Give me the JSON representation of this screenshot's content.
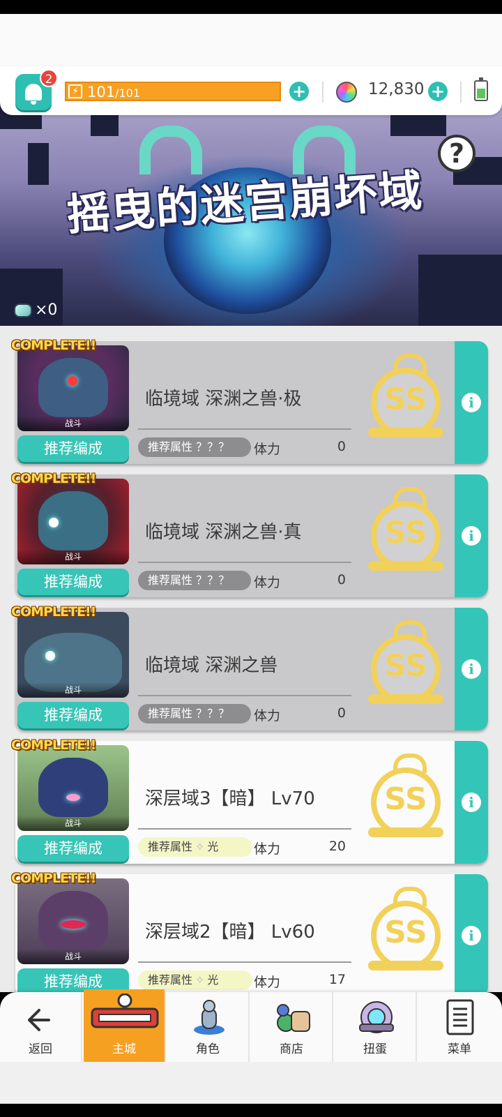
{
  "hud": {
    "notification_count": "2",
    "stamina_current": "101",
    "stamina_max": "/101",
    "gems": "12,830"
  },
  "banner": {
    "title": "摇曳的迷宫崩坏域",
    "help_label": "?",
    "ticket_count": "×0"
  },
  "quests": [
    {
      "complete_tag": "COMPLETE!!",
      "thumb_label": "战斗",
      "recommend_label": "推荐编成",
      "title": "临境域 深渊之兽·极",
      "attribute_label": "推荐属性 ？？？",
      "attribute_value": "",
      "stamina_label": "体力",
      "stamina_cost": "0",
      "rank": "SS"
    },
    {
      "complete_tag": "COMPLETE!!",
      "thumb_label": "战斗",
      "recommend_label": "推荐编成",
      "title": "临境域 深渊之兽·真",
      "attribute_label": "推荐属性 ？？？",
      "attribute_value": "",
      "stamina_label": "体力",
      "stamina_cost": "0",
      "rank": "SS"
    },
    {
      "complete_tag": "COMPLETE!!",
      "thumb_label": "战斗",
      "recommend_label": "推荐编成",
      "title": "临境域 深渊之兽",
      "attribute_label": "推荐属性 ？？？",
      "attribute_value": "",
      "stamina_label": "体力",
      "stamina_cost": "0",
      "rank": "SS"
    },
    {
      "complete_tag": "COMPLETE!!",
      "thumb_label": "战斗",
      "recommend_label": "推荐编成",
      "title": "深层域3【暗】 Lv70",
      "attribute_label": "推荐属性",
      "attribute_value": "光",
      "stamina_label": "体力",
      "stamina_cost": "20",
      "rank": "SS"
    },
    {
      "complete_tag": "COMPLETE!!",
      "thumb_label": "战斗",
      "recommend_label": "推荐编成",
      "title": "深层域2【暗】 Lv60",
      "attribute_label": "推荐属性",
      "attribute_value": "光",
      "stamina_label": "体力",
      "stamina_cost": "17",
      "rank": "SS"
    }
  ],
  "nav": {
    "back": "返回",
    "main_city": "主城",
    "character": "角色",
    "shop": "商店",
    "gacha": "扭蛋",
    "menu": "菜单"
  },
  "colors": {
    "accent": "#33c6b8",
    "stamina": "#f7a022",
    "rank_gold": "#f2d15a",
    "badge": "#e8453c"
  }
}
